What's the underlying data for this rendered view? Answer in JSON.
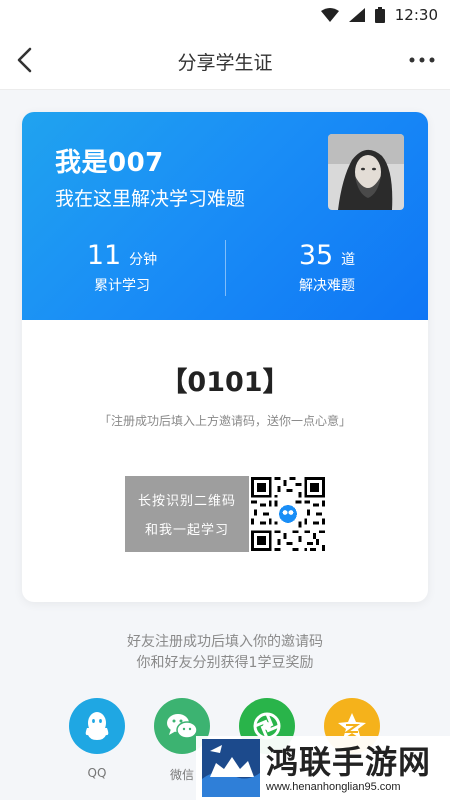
{
  "status_bar": {
    "time": "12:30",
    "icons": [
      "wifi-icon",
      "signal-icon",
      "battery-icon"
    ]
  },
  "nav": {
    "title": "分享学生证",
    "back_icon": "back-arrow-icon",
    "more_icon": "more-dots-icon"
  },
  "card": {
    "user_name": "我是007",
    "slogan": "我在这里解决学习难题",
    "stats": [
      {
        "value": "11",
        "unit": "分钟",
        "label": "累计学习"
      },
      {
        "value": "35",
        "unit": "道",
        "label": "解决难题"
      }
    ],
    "invite_code": "【0101】",
    "invite_hint": "「注册成功后填入上方邀请码，送你一点心意」",
    "qr_line1": "长按识别二维码",
    "qr_line2": "和我一起学习"
  },
  "footer": {
    "line1": "好友注册成功后填入你的邀请码",
    "line2": "你和好友分别获得1学豆奖励"
  },
  "share": [
    {
      "label": "QQ",
      "icon": "qq-icon",
      "color": "#1fa7e3"
    },
    {
      "label": "微信",
      "icon": "wechat-icon",
      "color": "#3cb371"
    },
    {
      "label": "",
      "icon": "moments-icon",
      "color": "#29b44a"
    },
    {
      "label": "",
      "icon": "qzone-icon",
      "color": "#f5b21b"
    }
  ],
  "watermark": {
    "title": "鸿联手游网",
    "url": "www.henanhonglian95.com"
  },
  "colors": {
    "header_gradient_start": "#20a3ef",
    "header_gradient_end": "#0f76f5",
    "page_background": "#f4f6f9"
  }
}
